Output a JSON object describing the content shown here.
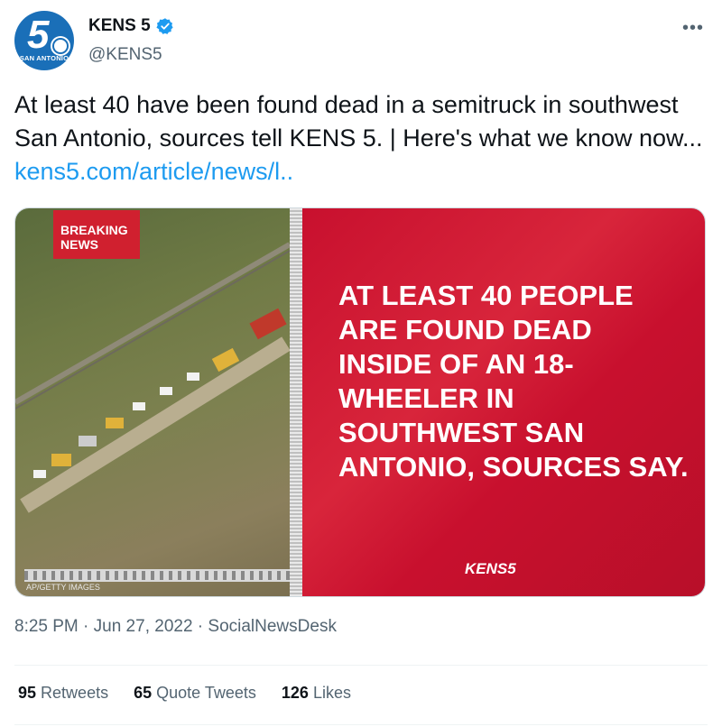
{
  "author": {
    "display_name": "KENS 5",
    "handle": "@KENS5",
    "avatar_number": "5",
    "avatar_city": "SAN ANTONIO"
  },
  "menu": {
    "more_label": "•••"
  },
  "tweet": {
    "text": "At least 40 have been found dead in a semitruck in southwest San Antonio, sources tell KENS 5. | Here's what we know now... ",
    "link": "kens5.com/article/news/l.."
  },
  "media": {
    "badge": "BREAKING NEWS",
    "credit": "AP/GETTY IMAGES",
    "headline": "AT LEAST 40 PEOPLE ARE FOUND DEAD INSIDE OF AN 18-WHEELER IN SOUTHWEST SAN ANTONIO, SOURCES SAY.",
    "logo": "KENS5"
  },
  "meta": {
    "timestamp": "8:25 PM · Jun 27, 2022 · SocialNewsDesk"
  },
  "stats": {
    "retweets_count": "95",
    "retweets_label": "Retweets",
    "quotes_count": "65",
    "quotes_label": "Quote Tweets",
    "likes_count": "126",
    "likes_label": "Likes"
  },
  "colors": {
    "link": "#1d9bf0",
    "card_red": "#c8102e",
    "verified": "#1d9bf0"
  }
}
